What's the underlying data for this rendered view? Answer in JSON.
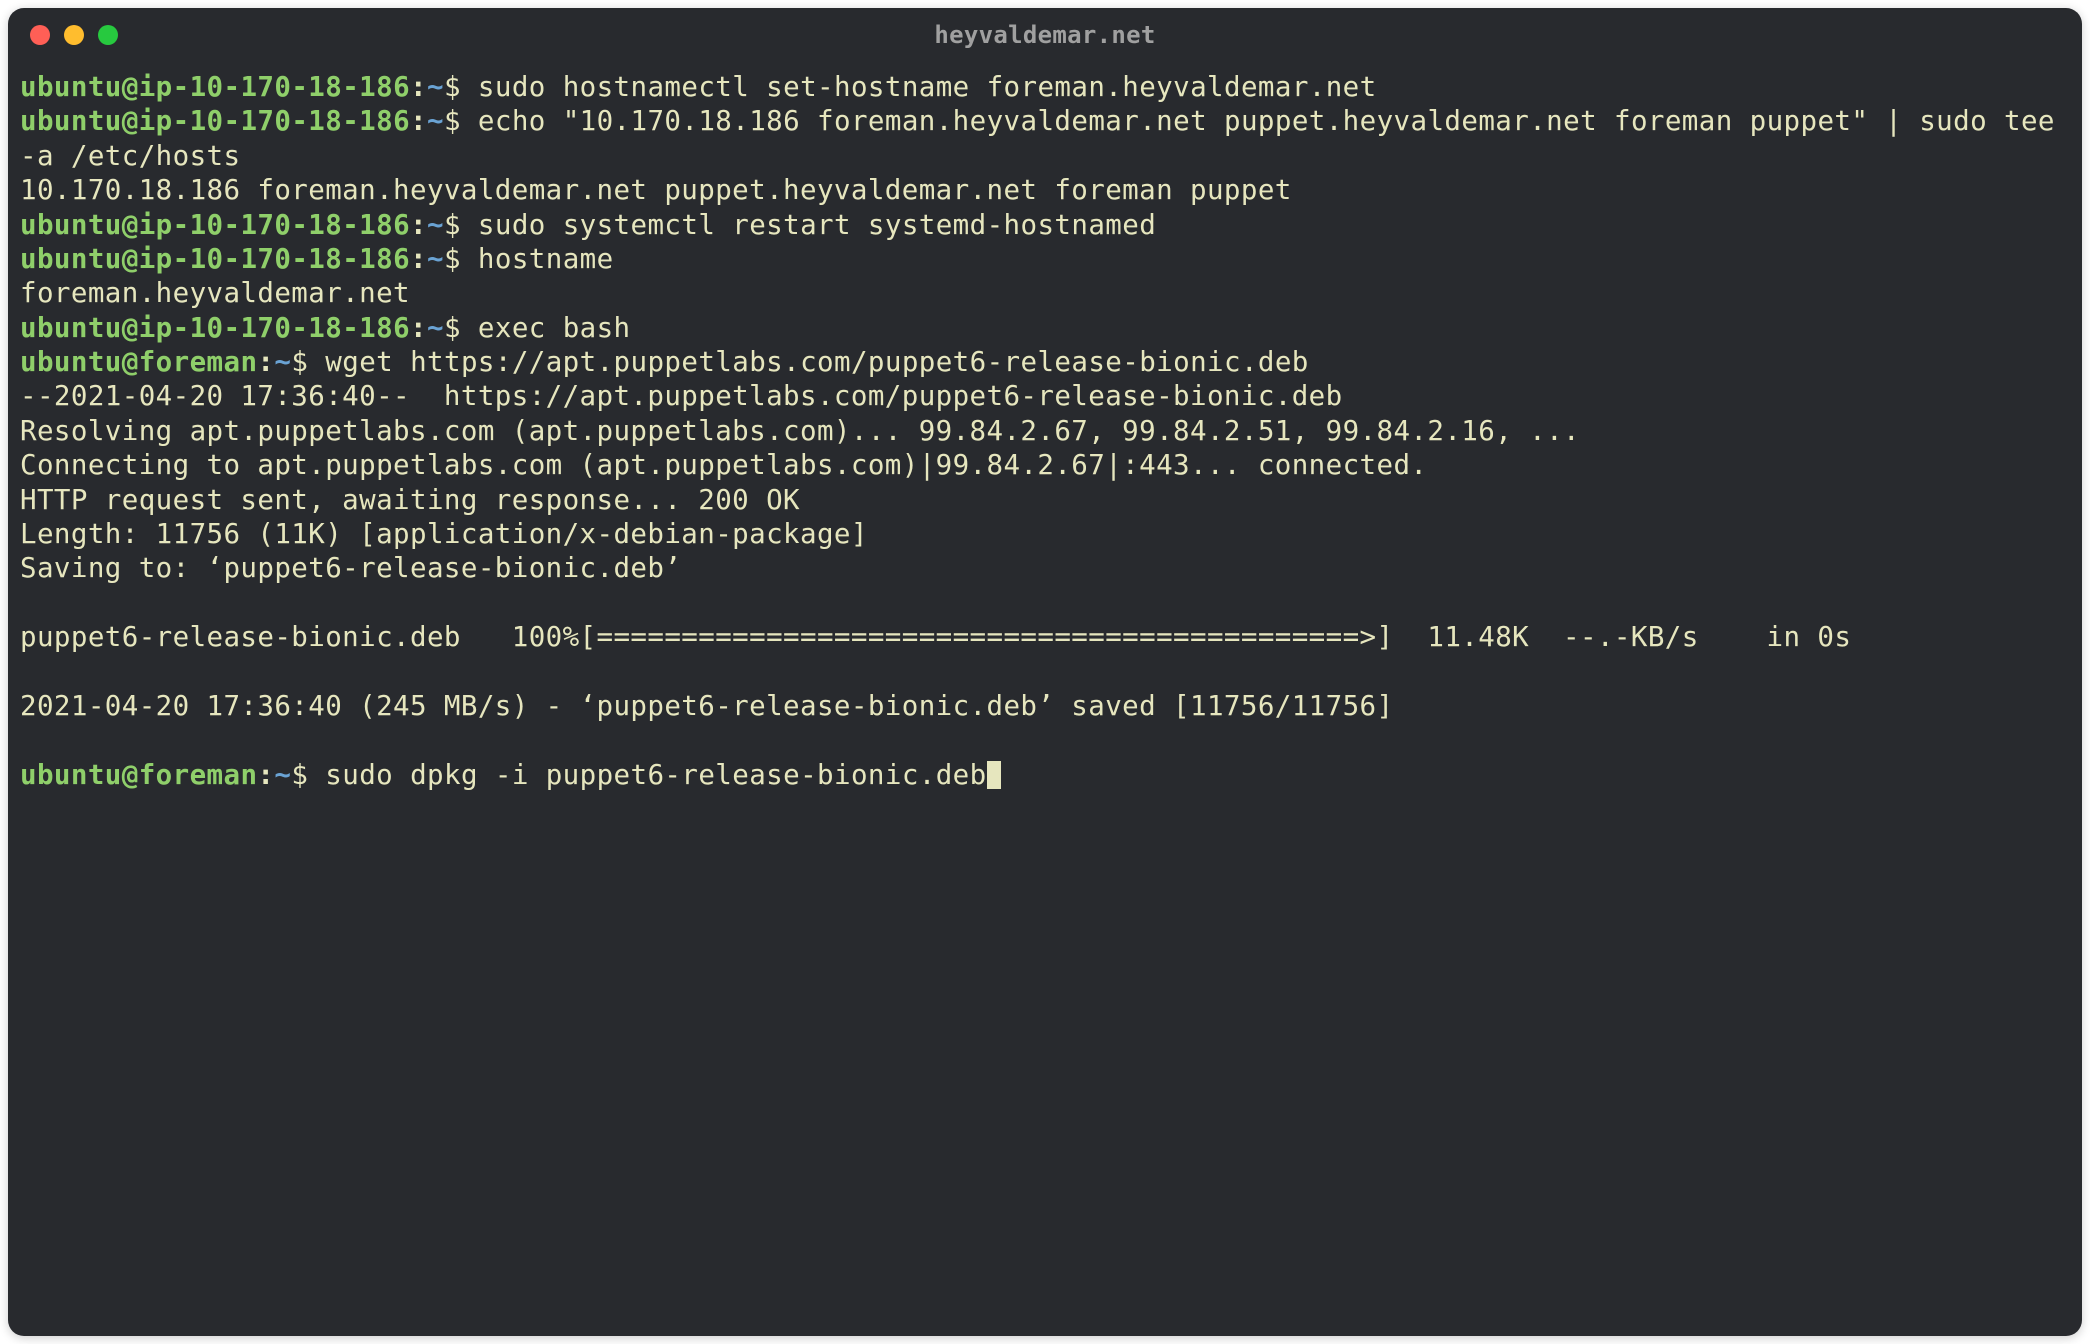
{
  "window": {
    "title": "heyvaldemar.net"
  },
  "colors": {
    "window_bg": "#282a2e",
    "text": "#e6e6be",
    "prompt_user_host": "#8fcf6a",
    "prompt_path": "#6aa3d4",
    "traffic_close": "#ff5f56",
    "traffic_min": "#ffbd2e",
    "traffic_max": "#27c93f"
  },
  "prompts": {
    "p1": {
      "user": "ubuntu",
      "host": "ip-10-170-18-186",
      "path": "~",
      "symbol": "$"
    },
    "p2": {
      "user": "ubuntu",
      "host": "foreman",
      "path": "~",
      "symbol": "$"
    }
  },
  "commands": {
    "cmd1": "sudo hostnamectl set-hostname foreman.heyvaldemar.net",
    "cmd2": "echo \"10.170.18.186 foreman.heyvaldemar.net puppet.heyvaldemar.net foreman puppet\" | sudo tee -a /etc/hosts",
    "cmd3": "sudo systemctl restart systemd-hostnamed",
    "cmd4": "hostname",
    "cmd5": "exec bash",
    "cmd6": "wget https://apt.puppetlabs.com/puppet6-release-bionic.deb",
    "cmd7": "sudo dpkg -i puppet6-release-bionic.deb"
  },
  "output": {
    "tee_out": "10.170.18.186 foreman.heyvaldemar.net puppet.heyvaldemar.net foreman puppet",
    "hostname_out": "foreman.heyvaldemar.net",
    "wget_line1": "--2021-04-20 17:36:40--  https://apt.puppetlabs.com/puppet6-release-bionic.deb",
    "wget_line2": "Resolving apt.puppetlabs.com (apt.puppetlabs.com)... 99.84.2.67, 99.84.2.51, 99.84.2.16, ...",
    "wget_line3": "Connecting to apt.puppetlabs.com (apt.puppetlabs.com)|99.84.2.67|:443... connected.",
    "wget_line4": "HTTP request sent, awaiting response... 200 OK",
    "wget_line5": "Length: 11756 (11K) [application/x-debian-package]",
    "wget_line6": "Saving to: ‘puppet6-release-bionic.deb’",
    "wget_progress": "puppet6-release-bionic.deb   100%[=============================================>]  11.48K  --.-KB/s    in 0s",
    "wget_done": "2021-04-20 17:36:40 (245 MB/s) - ‘puppet6-release-bionic.deb’ saved [11756/11756]"
  }
}
